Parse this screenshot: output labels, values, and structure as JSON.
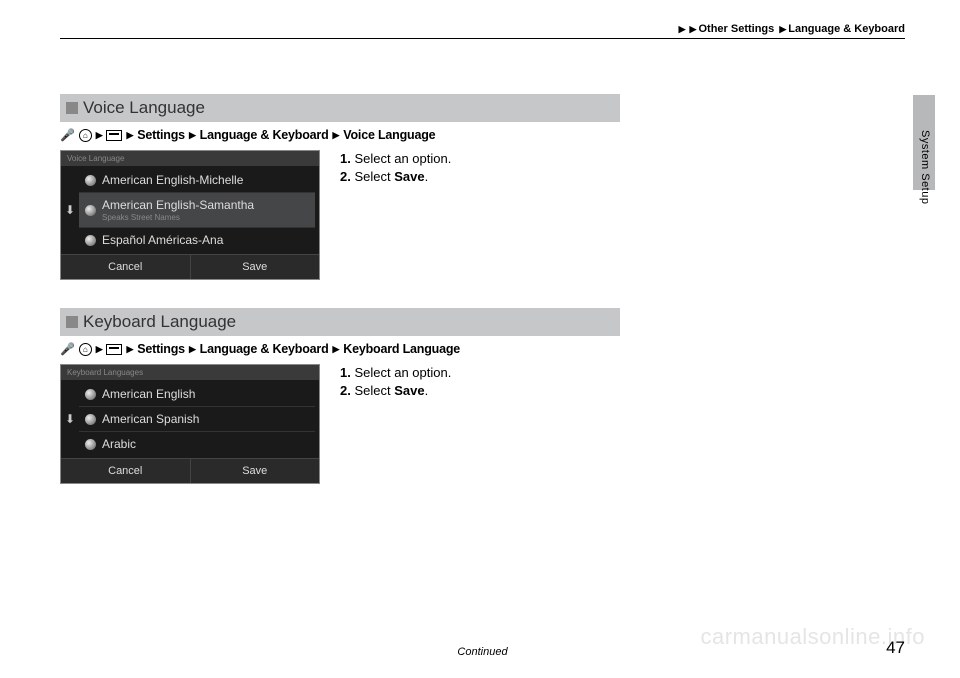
{
  "breadcrumb": {
    "part1": "Other Settings",
    "part2": "Language & Keyboard"
  },
  "side_label": "System Setup",
  "sections": {
    "voice": {
      "title": "Voice Language",
      "path": {
        "settings": "Settings",
        "group": "Language & Keyboard",
        "item": "Voice Language"
      },
      "ss_title": "Voice Language",
      "opt1": "American English-Michelle",
      "opt2": "American English-Samantha",
      "opt2_sub": "Speaks Street Names",
      "opt3": "Español Américas-Ana",
      "cancel": "Cancel",
      "save": "Save",
      "step1": "Select an option.",
      "step2_a": "Select ",
      "step2_b": "Save",
      "step2_c": "."
    },
    "keyboard": {
      "title": "Keyboard Language",
      "path": {
        "settings": "Settings",
        "group": "Language & Keyboard",
        "item": "Keyboard Language"
      },
      "ss_title": "Keyboard Languages",
      "opt1": "American English",
      "opt2": "American Spanish",
      "opt3": "Arabic",
      "cancel": "Cancel",
      "save": "Save",
      "step1": "Select an option.",
      "step2_a": "Select ",
      "step2_b": "Save",
      "step2_c": "."
    }
  },
  "continued": "Continued",
  "page_number": "47",
  "watermark": "carmanualsonline.info"
}
